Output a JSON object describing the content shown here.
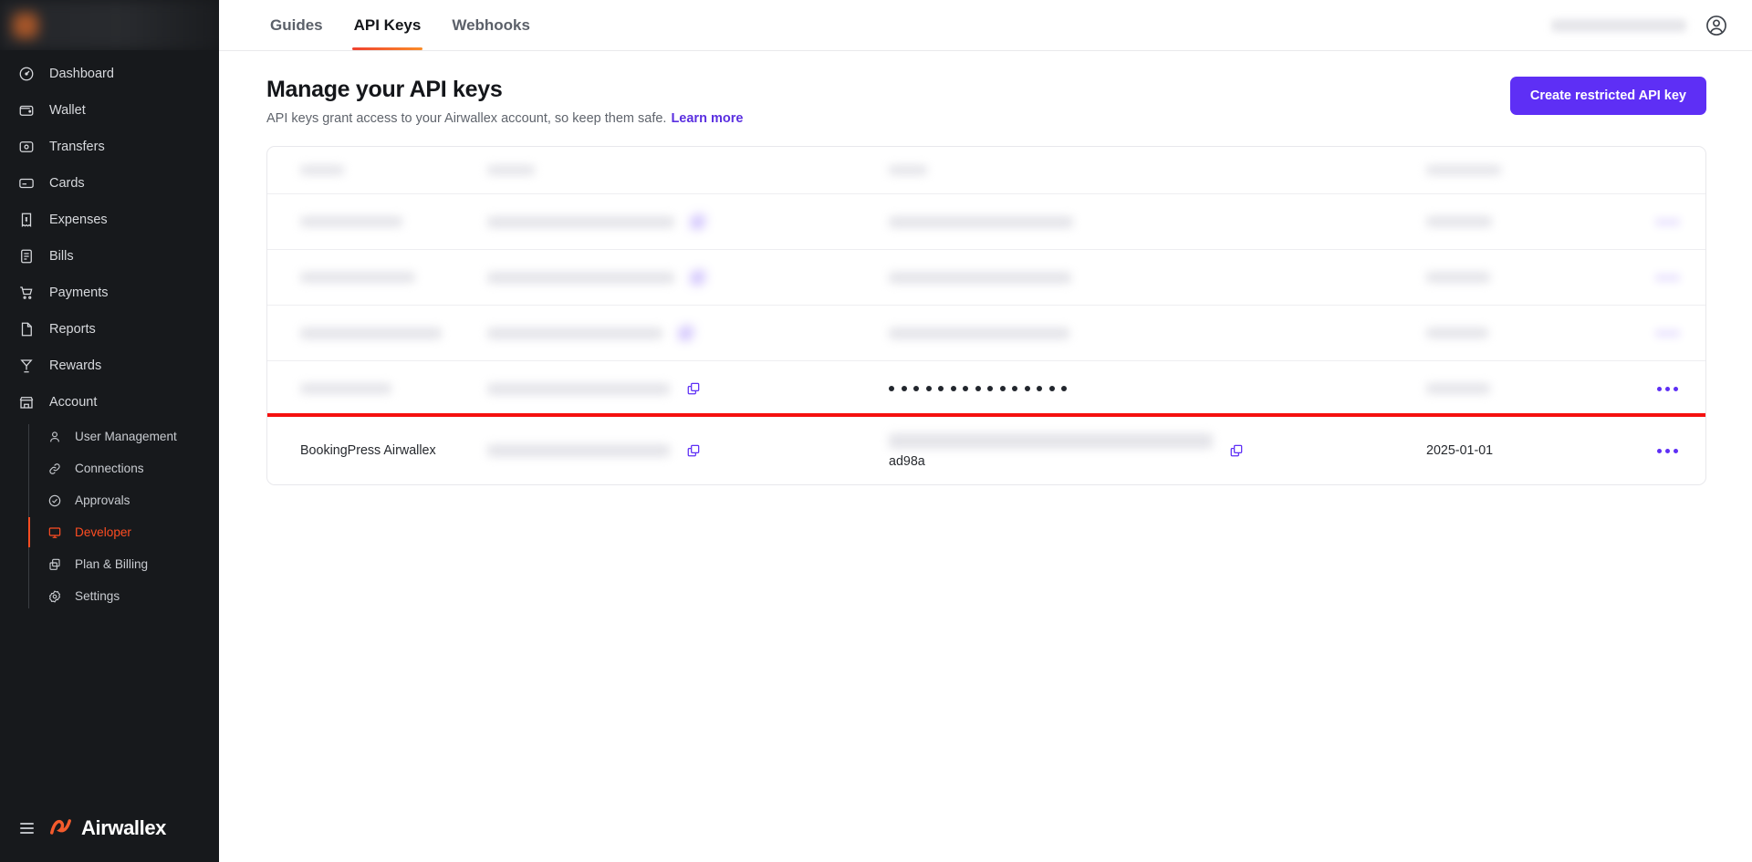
{
  "sidebar": {
    "account_switcher": {
      "redacted": true,
      "name": "account-switcher"
    },
    "items": [
      {
        "label": "Dashboard",
        "icon": "dashboard-icon"
      },
      {
        "label": "Wallet",
        "icon": "wallet-icon"
      },
      {
        "label": "Transfers",
        "icon": "transfers-icon"
      },
      {
        "label": "Cards",
        "icon": "cards-icon"
      },
      {
        "label": "Expenses",
        "icon": "expenses-icon"
      },
      {
        "label": "Bills",
        "icon": "bills-icon"
      },
      {
        "label": "Payments",
        "icon": "payments-icon"
      },
      {
        "label": "Reports",
        "icon": "reports-icon"
      },
      {
        "label": "Rewards",
        "icon": "rewards-icon"
      },
      {
        "label": "Account",
        "icon": "account-icon"
      }
    ],
    "subitems": [
      {
        "label": "User Management",
        "icon": "user-icon",
        "active": false
      },
      {
        "label": "Connections",
        "icon": "link-icon",
        "active": false
      },
      {
        "label": "Approvals",
        "icon": "check-circle-icon",
        "active": false
      },
      {
        "label": "Developer",
        "icon": "monitor-icon",
        "active": true
      },
      {
        "label": "Plan & Billing",
        "icon": "copy-stack-icon",
        "active": false
      },
      {
        "label": "Settings",
        "icon": "gear-icon",
        "active": false
      }
    ],
    "footer": {
      "brand": "Airwallex",
      "menu_icon": "hamburger-icon",
      "logo_icon": "airwallex-logo-icon"
    },
    "active_color": "#ff4d22"
  },
  "topbar": {
    "tabs": [
      {
        "label": "Guides",
        "active": false
      },
      {
        "label": "API Keys",
        "active": true
      },
      {
        "label": "Webhooks",
        "active": false
      }
    ],
    "account_name_redacted": true,
    "avatar_icon": "user-circle-icon"
  },
  "page": {
    "title": "Manage your API keys",
    "subtitle": "API keys grant access to your Airwallex account, so keep them safe.",
    "learn_more": "Learn more",
    "create_button": "Create restricted API key",
    "accent_purple": "#5e2ff5",
    "link_purple": "#5a2fe0"
  },
  "table": {
    "headers": [
      {
        "label": "",
        "redacted": true
      },
      {
        "label": "",
        "redacted": true
      },
      {
        "label": "",
        "redacted": true
      },
      {
        "label": "",
        "redacted": true
      },
      {
        "label": "",
        "redacted": true
      }
    ],
    "rows": [
      {
        "name": "",
        "name_redacted": true,
        "client_id": "",
        "client_id_redacted": true,
        "api_key": "",
        "api_key_redacted": true,
        "date": "",
        "date_redacted": true,
        "menu_redacted": true,
        "highlighted": false,
        "masked_key": false
      },
      {
        "name": "",
        "name_redacted": true,
        "client_id": "",
        "client_id_redacted": true,
        "api_key": "",
        "api_key_redacted": true,
        "date": "",
        "date_redacted": true,
        "menu_redacted": true,
        "highlighted": false,
        "masked_key": false
      },
      {
        "name": "",
        "name_redacted": true,
        "client_id": "",
        "client_id_redacted": true,
        "api_key": "",
        "api_key_redacted": true,
        "date": "",
        "date_redacted": true,
        "menu_redacted": true,
        "highlighted": false,
        "masked_key": false
      },
      {
        "name": "",
        "name_redacted": true,
        "client_id": "",
        "client_id_redacted": true,
        "api_key": "",
        "api_key_redacted": false,
        "date": "",
        "date_redacted": true,
        "menu_redacted": false,
        "highlighted": false,
        "masked_key": true,
        "masked_dots": 15
      },
      {
        "name": "BookingPress Airwallex",
        "name_redacted": false,
        "client_id": "",
        "client_id_redacted": true,
        "api_key_suffix": "ad98a",
        "api_key_redacted": true,
        "date": "2025-01-01",
        "date_redacted": false,
        "menu_redacted": false,
        "highlighted": true,
        "masked_key": false
      }
    ],
    "copy_icon": "copy-icon",
    "menu_icon": "kebab-menu-icon",
    "highlight_color": "#f5100f"
  }
}
